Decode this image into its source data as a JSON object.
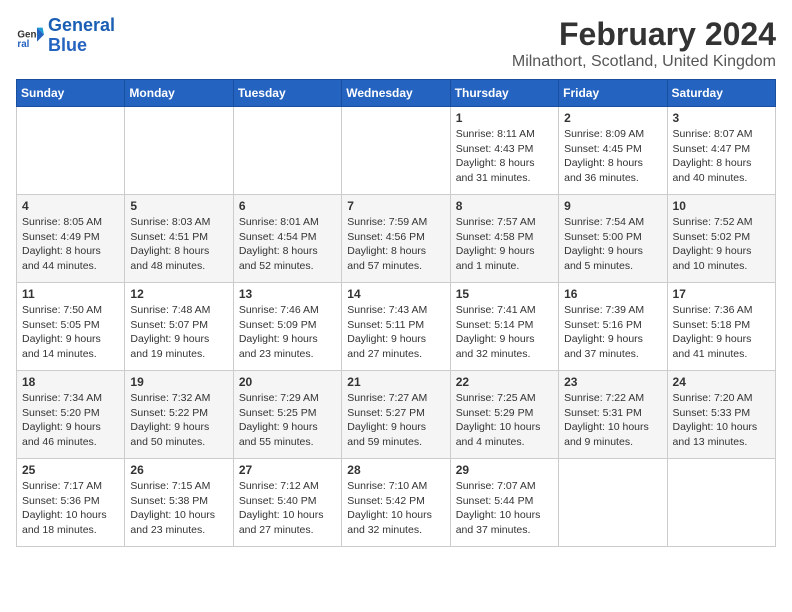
{
  "logo": {
    "line1": "General",
    "line2": "Blue"
  },
  "title": "February 2024",
  "location": "Milnathort, Scotland, United Kingdom",
  "weekdays": [
    "Sunday",
    "Monday",
    "Tuesday",
    "Wednesday",
    "Thursday",
    "Friday",
    "Saturday"
  ],
  "weeks": [
    [
      {
        "day": "",
        "info": ""
      },
      {
        "day": "",
        "info": ""
      },
      {
        "day": "",
        "info": ""
      },
      {
        "day": "",
        "info": ""
      },
      {
        "day": "1",
        "info": "Sunrise: 8:11 AM\nSunset: 4:43 PM\nDaylight: 8 hours\nand 31 minutes."
      },
      {
        "day": "2",
        "info": "Sunrise: 8:09 AM\nSunset: 4:45 PM\nDaylight: 8 hours\nand 36 minutes."
      },
      {
        "day": "3",
        "info": "Sunrise: 8:07 AM\nSunset: 4:47 PM\nDaylight: 8 hours\nand 40 minutes."
      }
    ],
    [
      {
        "day": "4",
        "info": "Sunrise: 8:05 AM\nSunset: 4:49 PM\nDaylight: 8 hours\nand 44 minutes."
      },
      {
        "day": "5",
        "info": "Sunrise: 8:03 AM\nSunset: 4:51 PM\nDaylight: 8 hours\nand 48 minutes."
      },
      {
        "day": "6",
        "info": "Sunrise: 8:01 AM\nSunset: 4:54 PM\nDaylight: 8 hours\nand 52 minutes."
      },
      {
        "day": "7",
        "info": "Sunrise: 7:59 AM\nSunset: 4:56 PM\nDaylight: 8 hours\nand 57 minutes."
      },
      {
        "day": "8",
        "info": "Sunrise: 7:57 AM\nSunset: 4:58 PM\nDaylight: 9 hours\nand 1 minute."
      },
      {
        "day": "9",
        "info": "Sunrise: 7:54 AM\nSunset: 5:00 PM\nDaylight: 9 hours\nand 5 minutes."
      },
      {
        "day": "10",
        "info": "Sunrise: 7:52 AM\nSunset: 5:02 PM\nDaylight: 9 hours\nand 10 minutes."
      }
    ],
    [
      {
        "day": "11",
        "info": "Sunrise: 7:50 AM\nSunset: 5:05 PM\nDaylight: 9 hours\nand 14 minutes."
      },
      {
        "day": "12",
        "info": "Sunrise: 7:48 AM\nSunset: 5:07 PM\nDaylight: 9 hours\nand 19 minutes."
      },
      {
        "day": "13",
        "info": "Sunrise: 7:46 AM\nSunset: 5:09 PM\nDaylight: 9 hours\nand 23 minutes."
      },
      {
        "day": "14",
        "info": "Sunrise: 7:43 AM\nSunset: 5:11 PM\nDaylight: 9 hours\nand 27 minutes."
      },
      {
        "day": "15",
        "info": "Sunrise: 7:41 AM\nSunset: 5:14 PM\nDaylight: 9 hours\nand 32 minutes."
      },
      {
        "day": "16",
        "info": "Sunrise: 7:39 AM\nSunset: 5:16 PM\nDaylight: 9 hours\nand 37 minutes."
      },
      {
        "day": "17",
        "info": "Sunrise: 7:36 AM\nSunset: 5:18 PM\nDaylight: 9 hours\nand 41 minutes."
      }
    ],
    [
      {
        "day": "18",
        "info": "Sunrise: 7:34 AM\nSunset: 5:20 PM\nDaylight: 9 hours\nand 46 minutes."
      },
      {
        "day": "19",
        "info": "Sunrise: 7:32 AM\nSunset: 5:22 PM\nDaylight: 9 hours\nand 50 minutes."
      },
      {
        "day": "20",
        "info": "Sunrise: 7:29 AM\nSunset: 5:25 PM\nDaylight: 9 hours\nand 55 minutes."
      },
      {
        "day": "21",
        "info": "Sunrise: 7:27 AM\nSunset: 5:27 PM\nDaylight: 9 hours\nand 59 minutes."
      },
      {
        "day": "22",
        "info": "Sunrise: 7:25 AM\nSunset: 5:29 PM\nDaylight: 10 hours\nand 4 minutes."
      },
      {
        "day": "23",
        "info": "Sunrise: 7:22 AM\nSunset: 5:31 PM\nDaylight: 10 hours\nand 9 minutes."
      },
      {
        "day": "24",
        "info": "Sunrise: 7:20 AM\nSunset: 5:33 PM\nDaylight: 10 hours\nand 13 minutes."
      }
    ],
    [
      {
        "day": "25",
        "info": "Sunrise: 7:17 AM\nSunset: 5:36 PM\nDaylight: 10 hours\nand 18 minutes."
      },
      {
        "day": "26",
        "info": "Sunrise: 7:15 AM\nSunset: 5:38 PM\nDaylight: 10 hours\nand 23 minutes."
      },
      {
        "day": "27",
        "info": "Sunrise: 7:12 AM\nSunset: 5:40 PM\nDaylight: 10 hours\nand 27 minutes."
      },
      {
        "day": "28",
        "info": "Sunrise: 7:10 AM\nSunset: 5:42 PM\nDaylight: 10 hours\nand 32 minutes."
      },
      {
        "day": "29",
        "info": "Sunrise: 7:07 AM\nSunset: 5:44 PM\nDaylight: 10 hours\nand 37 minutes."
      },
      {
        "day": "",
        "info": ""
      },
      {
        "day": "",
        "info": ""
      }
    ]
  ]
}
